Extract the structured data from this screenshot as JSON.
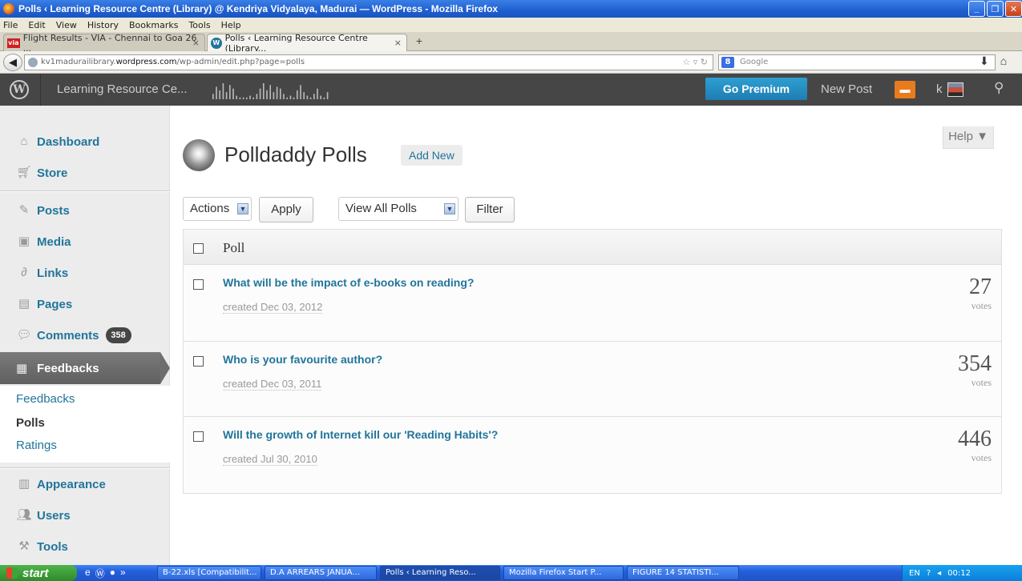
{
  "window": {
    "title": "Polls ‹ Learning Resource Centre (Library) @ Kendriya Vidyalaya, Madurai — WordPress - Mozilla Firefox",
    "menu": [
      "File",
      "Edit",
      "View",
      "History",
      "Bookmarks",
      "Tools",
      "Help"
    ],
    "tabs": [
      {
        "label": "Flight Results - VIA - Chennai to Goa 26 ...",
        "favicon": "via"
      },
      {
        "label": "Polls ‹ Learning Resource Centre (Library...",
        "favicon": "W"
      }
    ],
    "url_prefix": "kv1madurailibrary.",
    "url_domain": "wordpress.com",
    "url_path": "/wp-admin/edit.php?page=polls",
    "search_placeholder": "Google"
  },
  "adminbar": {
    "site_name": "Learning Resource Ce...",
    "go_premium": "Go Premium",
    "new_post": "New Post",
    "user": "k",
    "sparkline": [
      3,
      7,
      5,
      9,
      4,
      8,
      6,
      2,
      1,
      1,
      1,
      2,
      1,
      3,
      6,
      9,
      5,
      8,
      4,
      7,
      6,
      3,
      1,
      2,
      1,
      5,
      8,
      4,
      2,
      1,
      3,
      6,
      2,
      1,
      4
    ]
  },
  "sidebar": {
    "items": [
      {
        "label": "Dashboard",
        "icon": "house-icon"
      },
      {
        "label": "Store",
        "icon": "cart-icon"
      },
      {
        "label": "Posts",
        "icon": "pin-icon"
      },
      {
        "label": "Media",
        "icon": "media-icon"
      },
      {
        "label": "Links",
        "icon": "link-icon"
      },
      {
        "label": "Pages",
        "icon": "pages-icon"
      },
      {
        "label": "Comments",
        "icon": "comment-icon",
        "badge": "358"
      },
      {
        "label": "Feedbacks",
        "icon": "feedback-icon"
      },
      {
        "label": "Appearance",
        "icon": "appearance-icon"
      },
      {
        "label": "Users",
        "icon": "users-icon"
      },
      {
        "label": "Tools",
        "icon": "tools-icon"
      }
    ],
    "submenu": [
      "Feedbacks",
      "Polls",
      "Ratings"
    ]
  },
  "main": {
    "title": "Polldaddy Polls",
    "add_new": "Add New",
    "help": "Help ▼",
    "actions_select": "Actions",
    "apply": "Apply",
    "view_select": "View All Polls",
    "filter": "Filter",
    "column_header": "Poll",
    "votes_label": "votes",
    "polls": [
      {
        "question": "What will be the impact of e-books on reading?",
        "created": "created Dec 03, 2012",
        "votes": "27"
      },
      {
        "question": "Who is your favourite author?",
        "created": "created Dec 03, 2011",
        "votes": "354"
      },
      {
        "question": "Will the growth of Internet kill our 'Reading Habits'?",
        "created": "created Jul 30, 2010",
        "votes": "446"
      }
    ]
  },
  "taskbar": {
    "start": "start",
    "buttons": [
      "B-22.xls [Compatibilit...",
      "D.A ARREARS JANUA...",
      "Polls ‹ Learning Reso...",
      "Mozilla Firefox Start P...",
      "FIGURE 14 STATISTI..."
    ],
    "lang": "EN",
    "time": "00:12"
  }
}
